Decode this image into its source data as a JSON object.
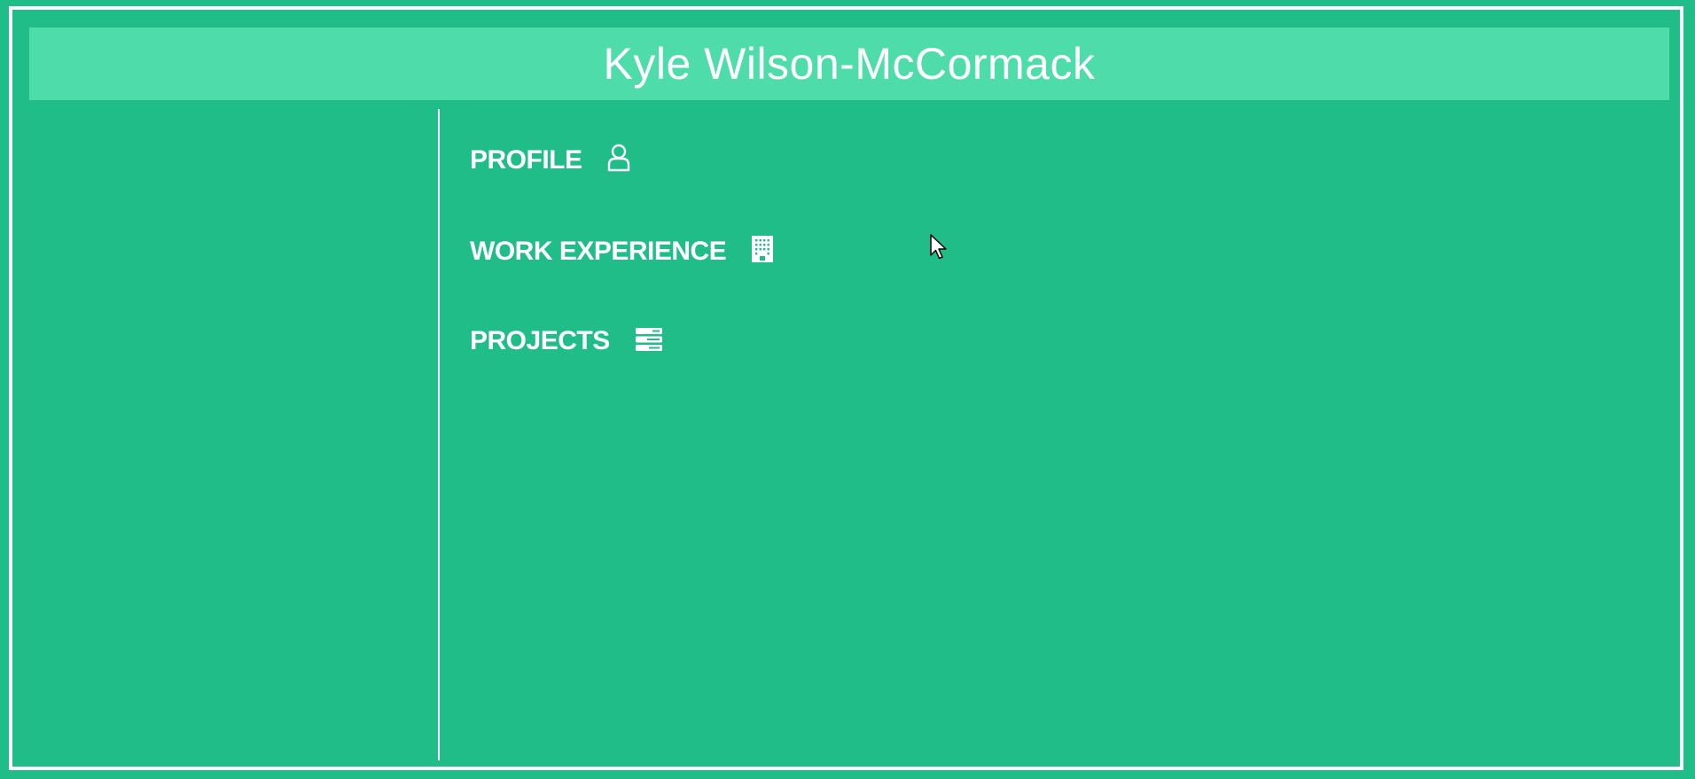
{
  "header": {
    "title": "Kyle Wilson-McCormack"
  },
  "nav": {
    "items": [
      {
        "label": "PROFILE",
        "icon": "user-icon"
      },
      {
        "label": "WORK EXPERIENCE",
        "icon": "building-icon"
      },
      {
        "label": "PROJECTS",
        "icon": "server-icon"
      }
    ]
  },
  "colors": {
    "background": "#21bd89",
    "header_background": "#4edcab",
    "text": "#ffffff"
  }
}
